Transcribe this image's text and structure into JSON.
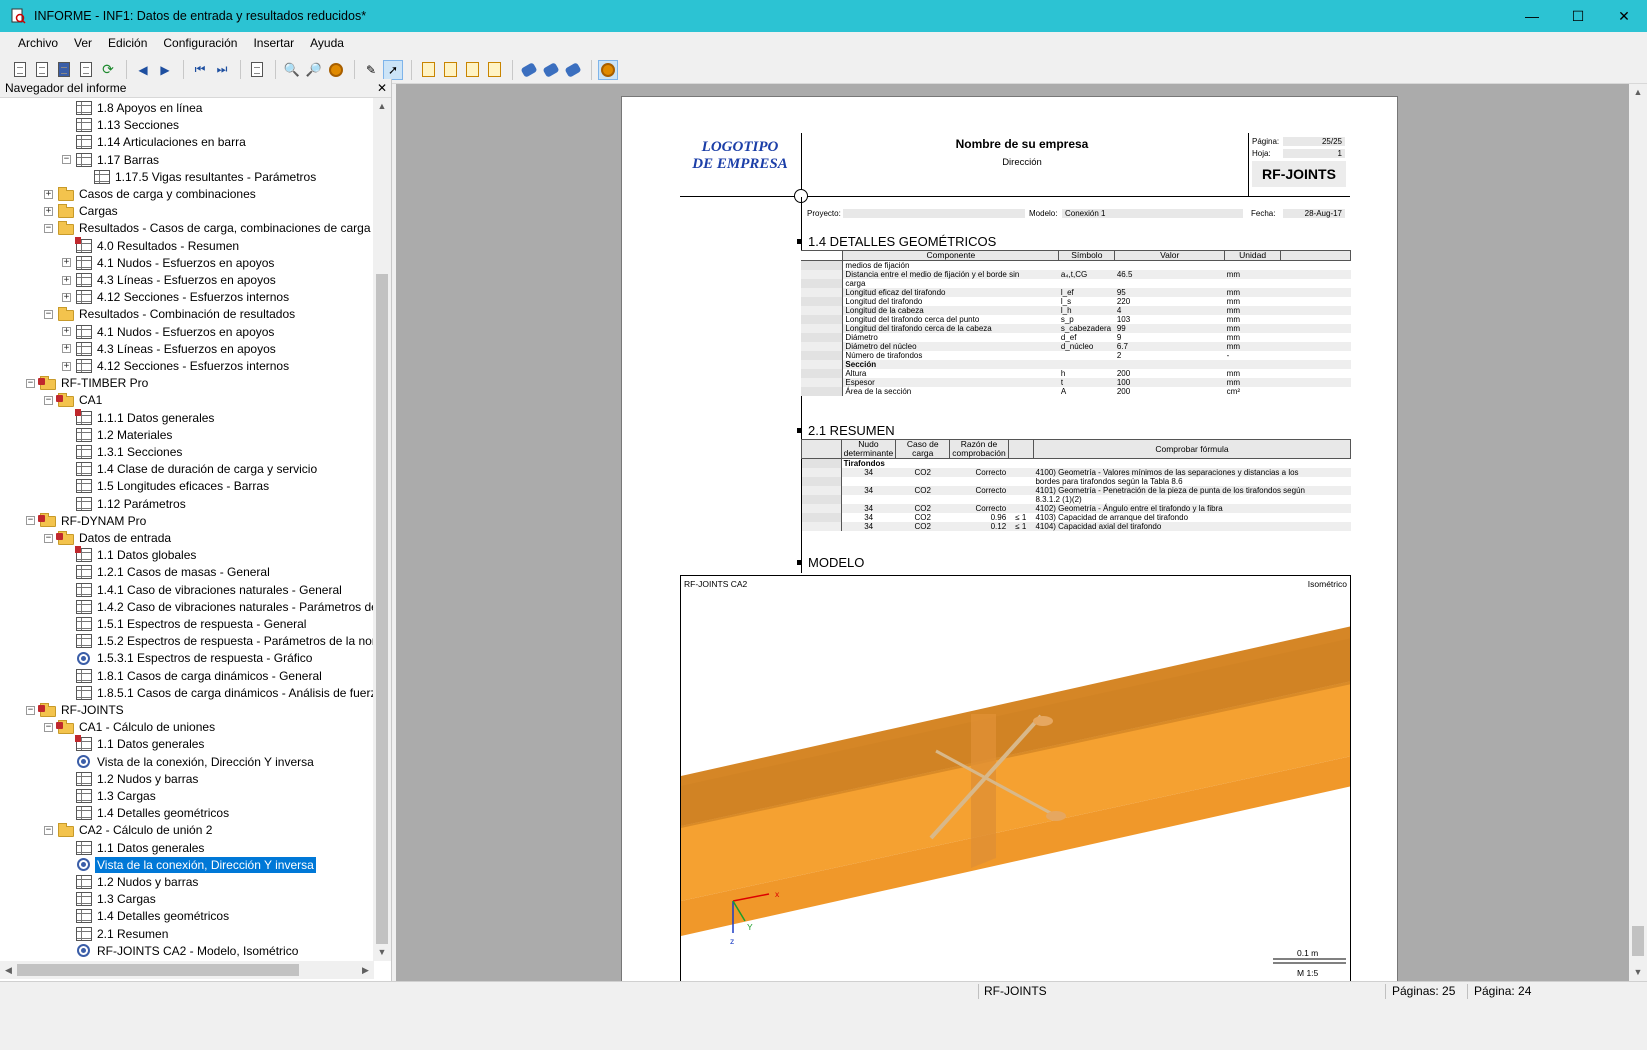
{
  "window": {
    "title": "INFORME - INF1: Datos de entrada y resultados reducidos*",
    "minimize": "—",
    "maximize": "☐",
    "close": "✕"
  },
  "menu": [
    "Archivo",
    "Ver",
    "Edición",
    "Configuración",
    "Insertar",
    "Ayuda"
  ],
  "navigator": {
    "title": "Navegador del informe",
    "close": "✕",
    "items": [
      {
        "label": "1.8 Apoyos en línea",
        "level": 3,
        "icon": "table",
        "exp": ""
      },
      {
        "label": "1.13 Secciones",
        "level": 3,
        "icon": "table",
        "exp": ""
      },
      {
        "label": "1.14 Articulaciones en barra",
        "level": 3,
        "icon": "table",
        "exp": ""
      },
      {
        "label": "1.17 Barras",
        "level": 3,
        "icon": "table",
        "exp": "−"
      },
      {
        "label": "1.17.5 Vigas resultantes - Parámetros",
        "level": 4,
        "icon": "table",
        "exp": ""
      },
      {
        "label": "Casos de carga y combinaciones",
        "level": 2,
        "icon": "folder",
        "exp": "+"
      },
      {
        "label": "Cargas",
        "level": 2,
        "icon": "folder",
        "exp": "+"
      },
      {
        "label": "Resultados - Casos de carga, combinaciones de carga",
        "level": 2,
        "icon": "folder",
        "exp": "−"
      },
      {
        "label": "4.0 Resultados - Resumen",
        "level": 3,
        "icon": "table-flag",
        "exp": ""
      },
      {
        "label": "4.1 Nudos - Esfuerzos en apoyos",
        "level": 3,
        "icon": "table",
        "exp": "+"
      },
      {
        "label": "4.3 Líneas - Esfuerzos en apoyos",
        "level": 3,
        "icon": "table",
        "exp": "+"
      },
      {
        "label": "4.12 Secciones - Esfuerzos internos",
        "level": 3,
        "icon": "table",
        "exp": "+"
      },
      {
        "label": "Resultados - Combinación de resultados",
        "level": 2,
        "icon": "folder",
        "exp": "−"
      },
      {
        "label": "4.1 Nudos - Esfuerzos en apoyos",
        "level": 3,
        "icon": "table",
        "exp": "+"
      },
      {
        "label": "4.3 Líneas - Esfuerzos en apoyos",
        "level": 3,
        "icon": "table",
        "exp": "+"
      },
      {
        "label": "4.12 Secciones - Esfuerzos internos",
        "level": 3,
        "icon": "table",
        "exp": "+"
      },
      {
        "label": "RF-TIMBER Pro",
        "level": 1,
        "icon": "folder-special",
        "exp": "−"
      },
      {
        "label": "CA1",
        "level": 2,
        "icon": "folder-special",
        "exp": "−"
      },
      {
        "label": "1.1.1 Datos generales",
        "level": 3,
        "icon": "table-flag",
        "exp": ""
      },
      {
        "label": "1.2 Materiales",
        "level": 3,
        "icon": "table",
        "exp": ""
      },
      {
        "label": "1.3.1 Secciones",
        "level": 3,
        "icon": "table",
        "exp": ""
      },
      {
        "label": "1.4 Clase de duración de carga y servicio",
        "level": 3,
        "icon": "table",
        "exp": ""
      },
      {
        "label": "1.5 Longitudes eficaces - Barras",
        "level": 3,
        "icon": "table",
        "exp": ""
      },
      {
        "label": "1.12 Parámetros",
        "level": 3,
        "icon": "table",
        "exp": ""
      },
      {
        "label": "RF-DYNAM Pro",
        "level": 1,
        "icon": "folder-special",
        "exp": "−"
      },
      {
        "label": "Datos de entrada",
        "level": 2,
        "icon": "folder-special",
        "exp": "−"
      },
      {
        "label": "1.1 Datos globales",
        "level": 3,
        "icon": "table-flag",
        "exp": ""
      },
      {
        "label": "1.2.1 Casos de masas - General",
        "level": 3,
        "icon": "table",
        "exp": ""
      },
      {
        "label": "1.4.1 Caso de vibraciones naturales - General",
        "level": 3,
        "icon": "table",
        "exp": ""
      },
      {
        "label": "1.4.2 Caso de vibraciones naturales - Parámetros de cálc",
        "level": 3,
        "icon": "table",
        "exp": ""
      },
      {
        "label": "1.5.1 Espectros de respuesta - General",
        "level": 3,
        "icon": "table",
        "exp": ""
      },
      {
        "label": "1.5.2 Espectros de respuesta - Parámetros de la norma",
        "level": 3,
        "icon": "table",
        "exp": ""
      },
      {
        "label": "1.5.3.1 Espectros de respuesta - Gráfico",
        "level": 3,
        "icon": "eye",
        "exp": ""
      },
      {
        "label": "1.8.1 Casos de carga dinámicos - General",
        "level": 3,
        "icon": "table",
        "exp": ""
      },
      {
        "label": "1.8.5.1 Casos de carga dinámicos - Análisis de fuerzas es",
        "level": 3,
        "icon": "table",
        "exp": ""
      },
      {
        "label": "RF-JOINTS",
        "level": 1,
        "icon": "folder-special",
        "exp": "−"
      },
      {
        "label": "CA1 - Cálculo de uniones",
        "level": 2,
        "icon": "folder-special",
        "exp": "−"
      },
      {
        "label": "1.1 Datos generales",
        "level": 3,
        "icon": "table-flag",
        "exp": ""
      },
      {
        "label": "Vista de la conexión, Dirección Y inversa",
        "level": 3,
        "icon": "eye",
        "exp": ""
      },
      {
        "label": "1.2 Nudos y barras",
        "level": 3,
        "icon": "table",
        "exp": ""
      },
      {
        "label": "1.3 Cargas",
        "level": 3,
        "icon": "table",
        "exp": ""
      },
      {
        "label": "1.4 Detalles geométricos",
        "level": 3,
        "icon": "table",
        "exp": ""
      },
      {
        "label": "CA2 - Cálculo de unión 2",
        "level": 2,
        "icon": "folder",
        "exp": "−"
      },
      {
        "label": "1.1 Datos generales",
        "level": 3,
        "icon": "table",
        "exp": ""
      },
      {
        "label": "Vista de la conexión, Dirección Y inversa",
        "level": 3,
        "icon": "eye",
        "exp": "",
        "selected": true
      },
      {
        "label": "1.2 Nudos y barras",
        "level": 3,
        "icon": "table",
        "exp": ""
      },
      {
        "label": "1.3 Cargas",
        "level": 3,
        "icon": "table",
        "exp": ""
      },
      {
        "label": "1.4 Detalles geométricos",
        "level": 3,
        "icon": "table",
        "exp": ""
      },
      {
        "label": "2.1 Resumen",
        "level": 3,
        "icon": "table",
        "exp": ""
      },
      {
        "label": "RF-JOINTS CA2 - Modelo, Isométrico",
        "level": 3,
        "icon": "eye",
        "exp": ""
      }
    ]
  },
  "report": {
    "logo_line1": "LOGOTIPO",
    "logo_line2": "DE EMPRESA",
    "company_name": "Nombre de su empresa",
    "company_address": "Dirección",
    "page_label": "Página:",
    "page_value": "25/25",
    "sheet_label": "Hoja:",
    "sheet_value": "1",
    "module": "RF-JOINTS",
    "project_label": "Proyecto:",
    "model_label": "Modelo:",
    "model_value": "Conexión 1",
    "date_label": "Fecha:",
    "date_value": "28-Aug-17",
    "section1": {
      "title": "1.4 DETALLES GEOMÉTRICOS",
      "headers": [
        "Componente",
        "Símbolo",
        "Valor",
        "Unidad"
      ],
      "rows": [
        {
          "c": "medios de fijación",
          "s": "",
          "v": "",
          "u": ""
        },
        {
          "c": "Distancia entre el medio de fijación y el borde sin",
          "s": "a₄,t,CG",
          "v": "46.5",
          "u": "mm"
        },
        {
          "c": "carga",
          "s": "",
          "v": "",
          "u": ""
        },
        {
          "c": "Longitud eficaz del tirafondo",
          "s": "l_ef",
          "v": "95",
          "u": "mm"
        },
        {
          "c": "Longitud del tirafondo",
          "s": "l_s",
          "v": "220",
          "u": "mm"
        },
        {
          "c": "Longitud de la cabeza",
          "s": "l_h",
          "v": "4",
          "u": "mm"
        },
        {
          "c": "Longitud del tirafondo cerca del punto",
          "s": "s_p",
          "v": "103",
          "u": "mm"
        },
        {
          "c": "Longitud del tirafondo cerca de la cabeza",
          "s": "s_cabezadera",
          "v": "99",
          "u": "mm"
        },
        {
          "c": "Diámetro",
          "s": "d_ef",
          "v": "9",
          "u": "mm"
        },
        {
          "c": "Diámetro del núcleo",
          "s": "d_núcleo",
          "v": "6.7",
          "u": "mm"
        },
        {
          "c": "Número de tirafondos",
          "s": "",
          "v": "2",
          "u": "-"
        },
        {
          "c": "Sección",
          "s": "",
          "v": "",
          "u": "",
          "bold": true
        },
        {
          "c": "Altura",
          "s": "h",
          "v": "200",
          "u": "mm"
        },
        {
          "c": "Espesor",
          "s": "t",
          "v": "100",
          "u": "mm"
        },
        {
          "c": "Área de la sección",
          "s": "A",
          "v": "200",
          "u": "cm²"
        }
      ]
    },
    "section2": {
      "title": "2.1 RESUMEN",
      "headers": [
        "Nudo determinante",
        "Caso de carga",
        "Razón de comprobación",
        "",
        "Comprobar fórmula"
      ],
      "group": "Tirafondos",
      "rows": [
        {
          "n": "34",
          "lc": "CO2",
          "r": "Correcto",
          "x": "",
          "f": "4100) Geometría - Valores mínimos de las separaciones y distancias a los"
        },
        {
          "n": "",
          "lc": "",
          "r": "",
          "x": "",
          "f": "bordes para tirafondos según la Tabla 8.6"
        },
        {
          "n": "34",
          "lc": "CO2",
          "r": "Correcto",
          "x": "",
          "f": "4101) Geometría - Penetración de la pieza de punta de los tirafondos según"
        },
        {
          "n": "",
          "lc": "",
          "r": "",
          "x": "",
          "f": "8.3.1.2 (1)(2)"
        },
        {
          "n": "34",
          "lc": "CO2",
          "r": "Correcto",
          "x": "",
          "f": "4102) Geometría - Ángulo entre el tirafondo y la fibra"
        },
        {
          "n": "34",
          "lc": "CO2",
          "r": "0.96",
          "x": "≤ 1",
          "f": "4103) Capacidad de arranque del tirafondo"
        },
        {
          "n": "34",
          "lc": "CO2",
          "r": "0.12",
          "x": "≤ 1",
          "f": "4104) Capacidad axial del tirafondo"
        }
      ]
    },
    "section3": {
      "title": "MODELO",
      "view_name": "RF-JOINTS CA2",
      "view_type": "Isométrico",
      "scale_bar": "0.1 m",
      "scale": "M 1:5",
      "axis_x": "x",
      "axis_y": "Y",
      "axis_z": "z",
      "axis_z2": "z"
    }
  },
  "status": {
    "module": "RF-JOINTS",
    "pages": "Páginas: 25",
    "page": "Página: 24"
  },
  "colors": {
    "titlebar": "#2cc3d3",
    "selection": "#0078d7",
    "beam": "#f5a131"
  }
}
